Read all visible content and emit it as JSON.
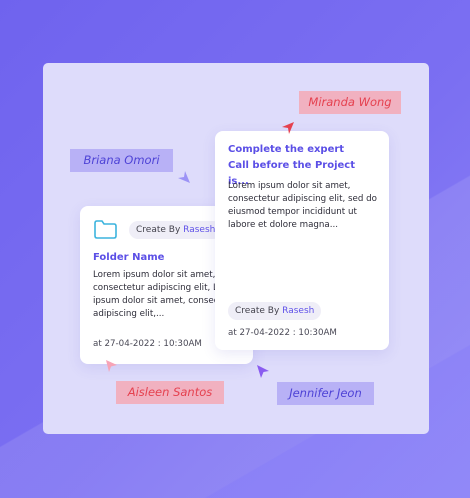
{
  "cards": [
    {
      "badge_prefix": "Create By",
      "badge_user": "Rasesh",
      "title": "Folder Name",
      "body_lines": [
        "Lorem ipsum dolor sit amet,",
        "consectetur adipiscing elit, Lo",
        "ipsum dolor sit amet, consec",
        "adipiscing elit,..."
      ],
      "date": "at 27-04-2022 : 10:30AM",
      "icon": "folder-icon"
    },
    {
      "title_lines": [
        "Complete the expert",
        "Call before the Project is..."
      ],
      "body_lines": [
        "Lorem ipsum dolor sit amet,",
        "consectetur adipiscing elit, sed do",
        "eiusmod tempor incididunt ut",
        "labore et dolore magna..."
      ],
      "badge_prefix": "Create By",
      "badge_user": "Rasesh",
      "date": "at 27-04-2022 : 10:30AM"
    }
  ],
  "collaborators": [
    {
      "name": "Miranda Wong",
      "color": "#e5414f",
      "cursor": "cursor-arrow-icon"
    },
    {
      "name": "Briana Omori",
      "color": "#8e85f6",
      "cursor": "cursor-arrow-icon"
    },
    {
      "name": "Aisleen Santos",
      "color": "#f7a3b6",
      "cursor": "cursor-arrow-icon"
    },
    {
      "name": "Jennifer Jeon",
      "color": "#8a5cf0",
      "cursor": "cursor-arrow-icon"
    }
  ],
  "colors": {
    "background": "#6f63ee",
    "board": "#dedcfb",
    "accent": "#5b4fe6",
    "red_tag": "#f1b1c0",
    "purple_tag": "#b8b1f6"
  }
}
